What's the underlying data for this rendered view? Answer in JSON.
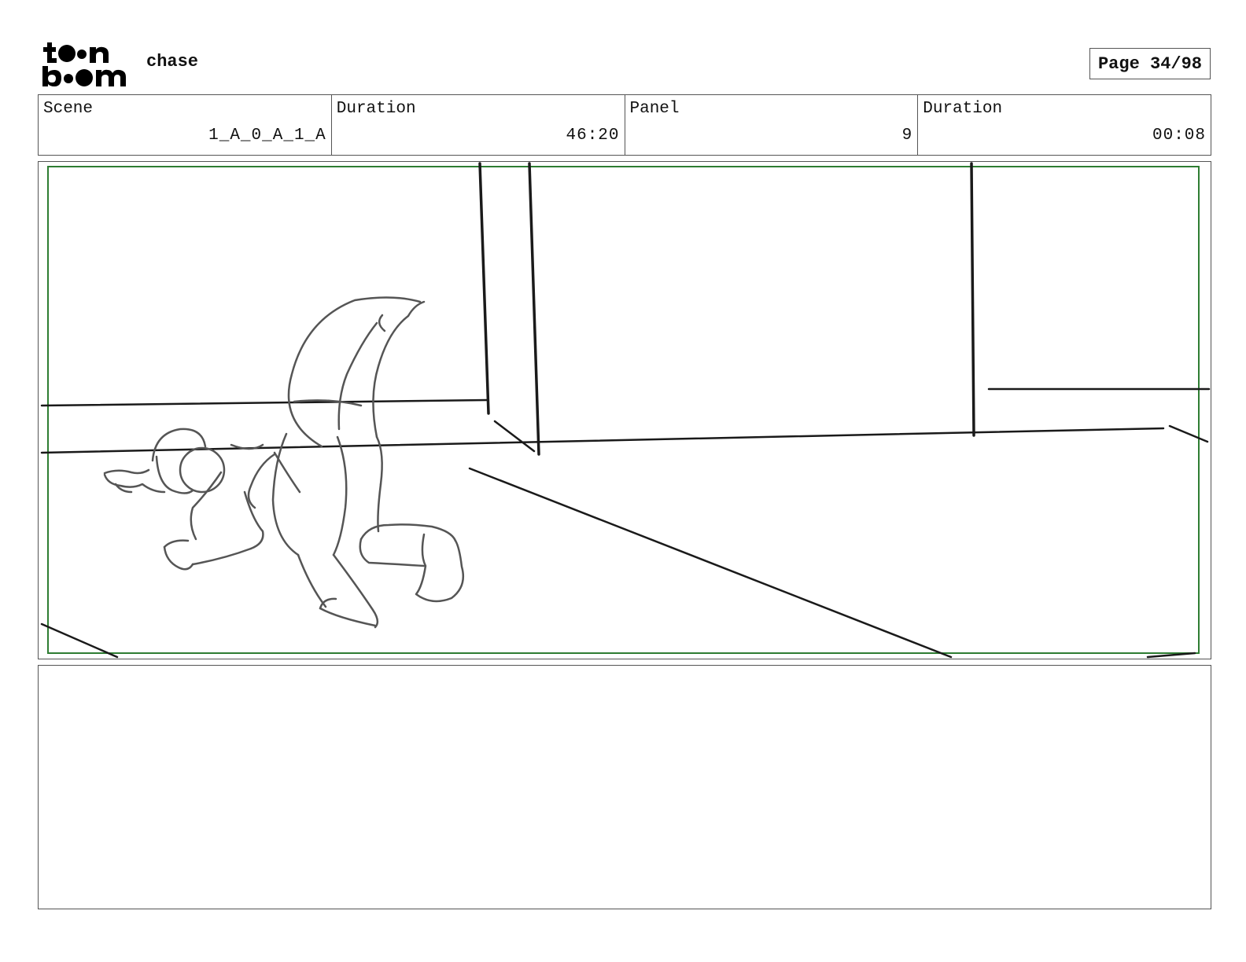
{
  "header": {
    "logo_text": "toon boom",
    "project_title": "chase",
    "page_label": "Page 34/98"
  },
  "info": [
    {
      "label": "Scene",
      "value": "1_A_0_A_1_A"
    },
    {
      "label": "Duration",
      "value": "46:20"
    },
    {
      "label": "Panel",
      "value": "9"
    },
    {
      "label": "Duration",
      "value": "00:08"
    }
  ],
  "panel": {
    "frame_color": "#2e7d32",
    "sketch_color": "#1a1a1a",
    "figure_color": "#555555"
  },
  "notes": {
    "text": ""
  }
}
